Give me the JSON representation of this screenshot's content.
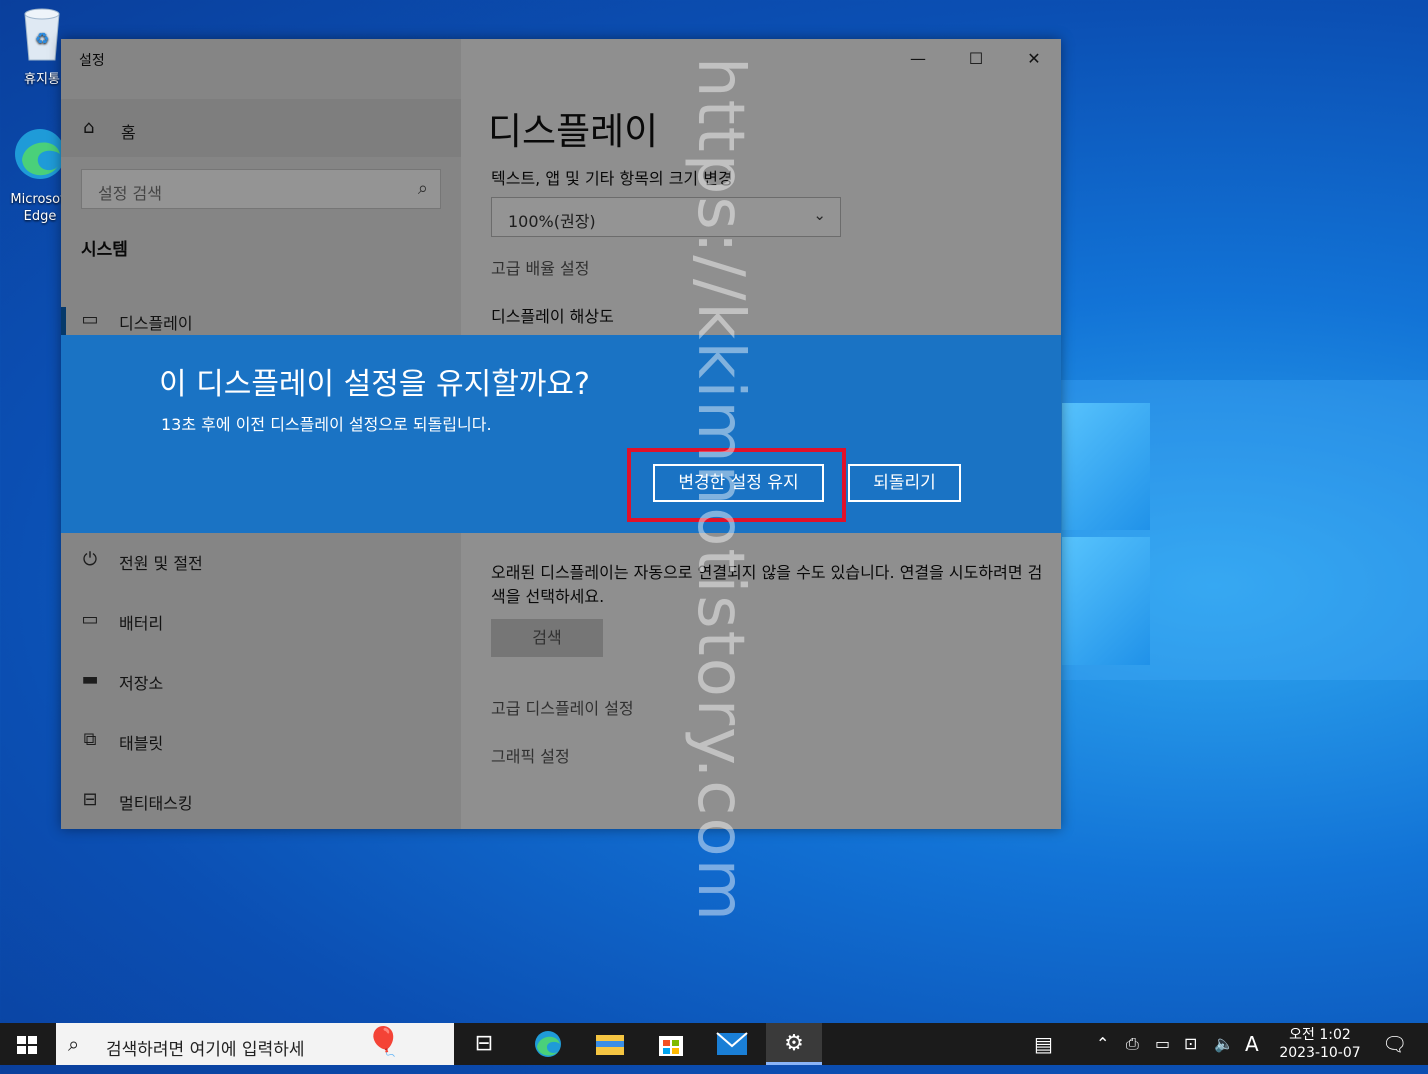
{
  "desktop": {
    "icons": [
      {
        "label": "휴지통",
        "icon": "recycle-bin-icon"
      },
      {
        "label": "Microsoft Edge",
        "icon": "edge-icon"
      }
    ]
  },
  "window": {
    "title": "설정",
    "controls": {
      "minimize": "—",
      "maximize": "☐",
      "close": "✕"
    },
    "sidebar": {
      "home_label": "홈",
      "search_placeholder": "설정 검색",
      "section": "시스템",
      "items": [
        {
          "label": "디스플레이",
          "icon": "monitor-icon",
          "active": true
        },
        {
          "label": "전원 및 절전",
          "icon": "power-icon"
        },
        {
          "label": "배터리",
          "icon": "battery-icon"
        },
        {
          "label": "저장소",
          "icon": "storage-icon"
        },
        {
          "label": "태블릿",
          "icon": "tablet-icon"
        },
        {
          "label": "멀티태스킹",
          "icon": "multitasking-icon"
        }
      ]
    },
    "main": {
      "heading": "디스플레이",
      "scale_label": "텍스트, 앱 및 기타 항목의 크기 변경",
      "scale_value": "100%(권장)",
      "advanced_scaling_link": "고급 배율 설정",
      "resolution_label": "디스플레이 해상도",
      "old_display_text": "오래된 디스플레이는 자동으로 연결되지 않을 수도 있습니다. 연결을 시도하려면 검색을 선택하세요.",
      "detect_button": "검색",
      "advanced_display_link": "고급 디스플레이 설정",
      "graphics_link": "그래픽 설정"
    }
  },
  "dialog": {
    "question": "이 디스플레이 설정을 유지할까요?",
    "countdown_text": "13초 후에 이전 디스플레이 설정으로 되돌립니다.",
    "keep_button": "변경한 설정 유지",
    "revert_button": "되돌리기",
    "highlight_color": "#e0112a"
  },
  "watermark": "https://kkimnotistory.com",
  "taskbar": {
    "search_placeholder": "검색하려면 여기에 입력하세",
    "apps": [
      "task-view-icon",
      "edge-icon",
      "file-explorer-icon",
      "store-icon",
      "mail-icon",
      "settings-icon"
    ],
    "tray_ime": "A",
    "clock_time": "오전 1:02",
    "clock_date": "2023-10-07"
  }
}
